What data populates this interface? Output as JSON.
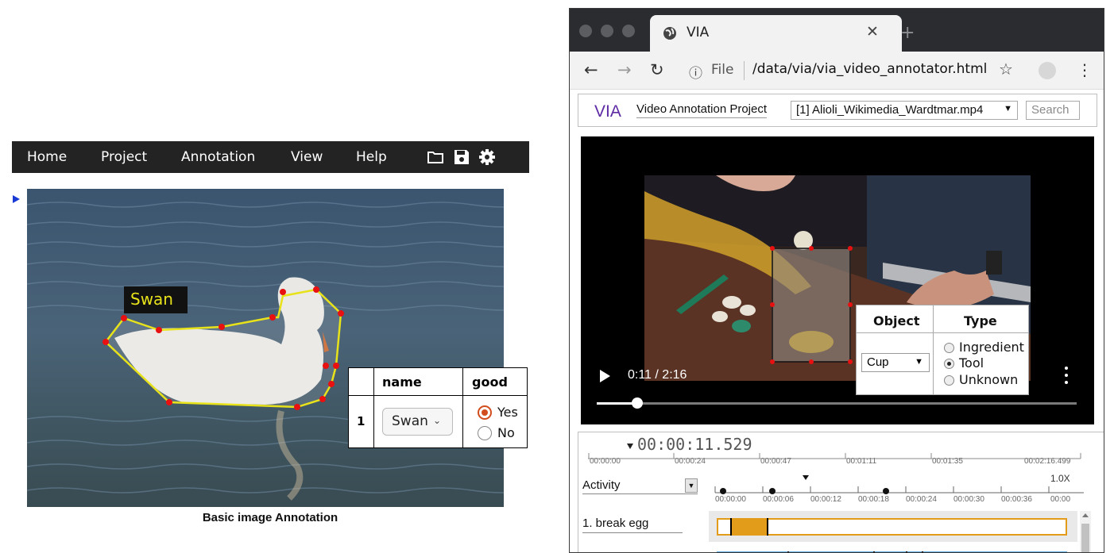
{
  "image_annotator": {
    "menu": [
      "Home",
      "Project",
      "Annotation",
      "View",
      "Help"
    ],
    "toolbar_icons": [
      "folder-icon",
      "save-icon",
      "gear-icon"
    ],
    "region_label": "Swan",
    "table": {
      "headers": [
        "name",
        "good"
      ],
      "row_index": "1",
      "name_value": "Swan",
      "good_options": [
        "Yes",
        "No"
      ],
      "good_selected": "Yes"
    },
    "caption": "Basic image Annotation",
    "colors": {
      "menubar": "#232323",
      "polygon": "#e8e21b",
      "vertex": "#e81010",
      "radio_accent": "#d14d1d"
    }
  },
  "browser": {
    "tab_title": "VIA",
    "url_scheme": "File",
    "url_path": "/data/via/via_video_annotator.html"
  },
  "via": {
    "logo": "VIA",
    "project_name": "Video Annotation Project",
    "file_selected": "[1] Alioli_Wikimedia_Wardtmar.mp4",
    "search_placeholder": "Search",
    "region_table": {
      "headers": [
        "Object",
        "Type"
      ],
      "object_value": "Cup",
      "type_options": [
        "Ingredient",
        "Tool",
        "Unknown"
      ],
      "type_selected": "Tool"
    },
    "video": {
      "time": "0:11 / 2:16",
      "progress": 0.085
    },
    "timeline": {
      "current_time": "00:00:11.529",
      "overview_ticks": [
        "00:00:00",
        "00:00:24",
        "00:00:47",
        "00:01:11",
        "00:01:35",
        "00:02:16.499"
      ],
      "attribute": "Activity",
      "zoom": "1.0X",
      "detail_ticks": [
        "00:00:00",
        "00:00:06",
        "00:00:12",
        "00:00:18",
        "00:00:24",
        "00:00:30",
        "00:00:36",
        "00:00"
      ],
      "track_label": "1. break egg",
      "colors": {
        "segment": "#e39b1a",
        "segment_2": "#59a8e0",
        "logo": "#5d2aa4"
      }
    }
  }
}
